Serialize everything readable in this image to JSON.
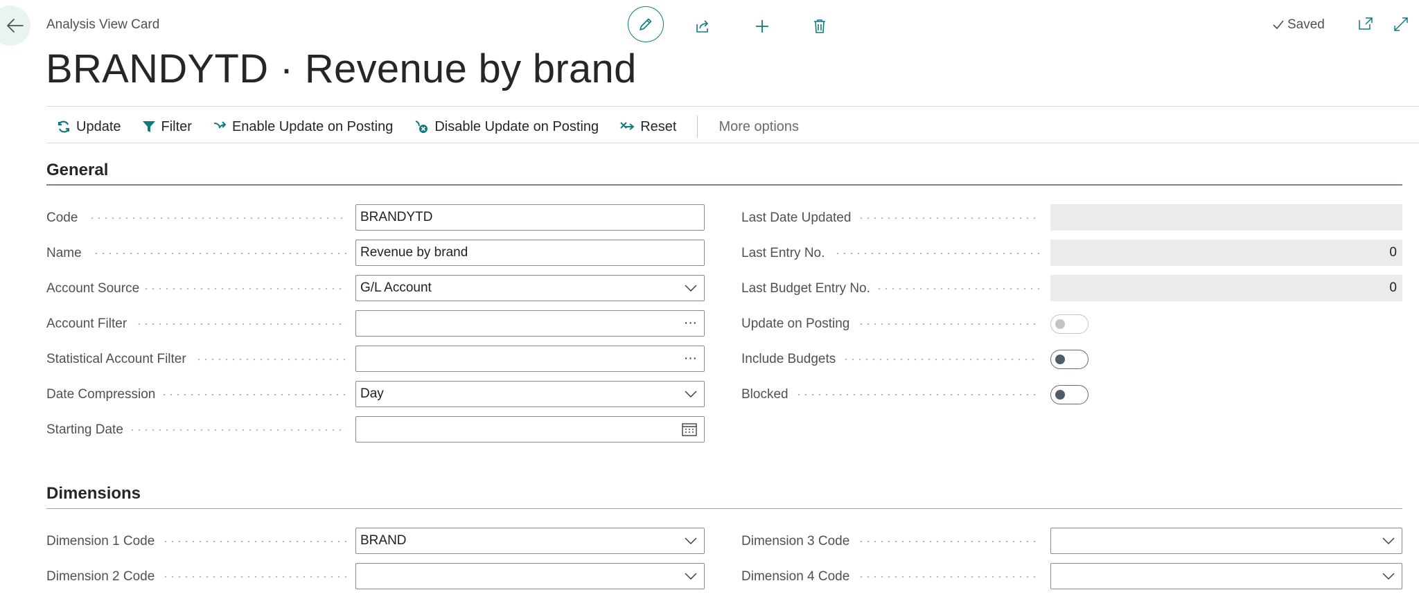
{
  "header": {
    "breadcrumb": "Analysis View Card",
    "saved_label": "Saved",
    "title": "BRANDYTD · Revenue by brand"
  },
  "colors": {
    "accent": "#0f7b7b",
    "readonly_bg": "#ebebeb"
  },
  "icons": {
    "back": "back-arrow-icon",
    "edit": "pencil-icon",
    "share": "share-icon",
    "new": "plus-icon",
    "delete": "trash-icon",
    "saved": "checkmark-icon",
    "open_new_window": "open-in-new-window-icon",
    "expand": "expand-icon"
  },
  "actions": {
    "update": "Update",
    "filter": "Filter",
    "enable_update": "Enable Update on Posting",
    "disable_update": "Disable Update on Posting",
    "reset": "Reset",
    "more": "More options"
  },
  "general": {
    "title": "General",
    "code": {
      "label": "Code",
      "value": "BRANDYTD"
    },
    "name": {
      "label": "Name",
      "value": "Revenue by brand"
    },
    "account_source": {
      "label": "Account Source",
      "value": "G/L Account"
    },
    "account_filter": {
      "label": "Account Filter",
      "value": ""
    },
    "stat_account_filter": {
      "label": "Statistical Account Filter",
      "value": ""
    },
    "date_compression": {
      "label": "Date Compression",
      "value": "Day"
    },
    "starting_date": {
      "label": "Starting Date",
      "value": ""
    },
    "last_date_updated": {
      "label": "Last Date Updated",
      "value": ""
    },
    "last_entry_no": {
      "label": "Last Entry No.",
      "value": "0"
    },
    "last_budget_entry_no": {
      "label": "Last Budget Entry No.",
      "value": "0"
    },
    "update_on_posting": {
      "label": "Update on Posting",
      "value": false
    },
    "include_budgets": {
      "label": "Include Budgets",
      "value": false
    },
    "blocked": {
      "label": "Blocked",
      "value": false
    },
    "ellipsis": "···"
  },
  "dimensions": {
    "title": "Dimensions",
    "dim1": {
      "label": "Dimension 1 Code",
      "value": "BRAND"
    },
    "dim2": {
      "label": "Dimension 2 Code",
      "value": ""
    },
    "dim3": {
      "label": "Dimension 3 Code",
      "value": ""
    },
    "dim4": {
      "label": "Dimension 4 Code",
      "value": ""
    }
  }
}
